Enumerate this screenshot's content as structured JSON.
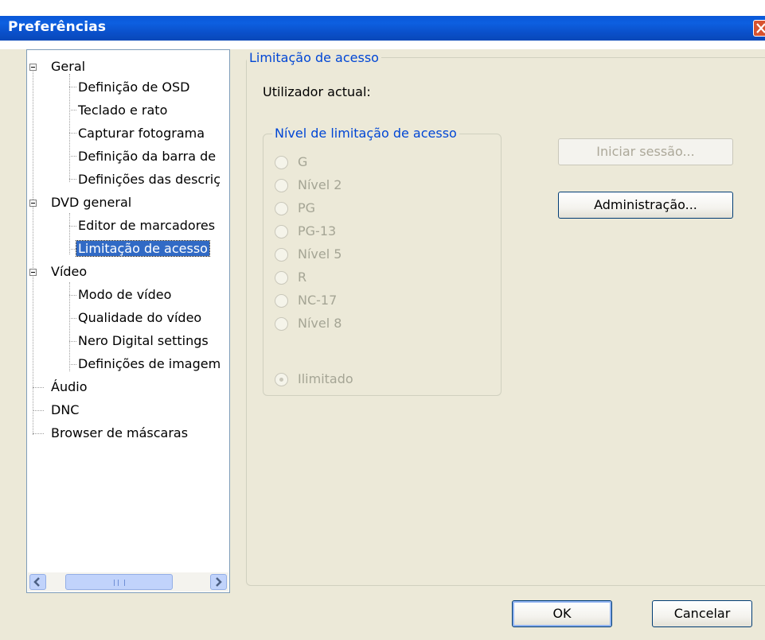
{
  "window": {
    "title": "Preferências",
    "close_icon": "close-icon"
  },
  "tree": {
    "items": [
      {
        "label": "Geral",
        "level": 0,
        "expanded": true
      },
      {
        "label": "Definição de OSD",
        "level": 1
      },
      {
        "label": "Teclado e rato",
        "level": 1
      },
      {
        "label": "Capturar fotograma",
        "level": 1
      },
      {
        "label": "Definição da barra de",
        "level": 1
      },
      {
        "label": "Definições das descriç",
        "level": 1
      },
      {
        "label": "DVD general",
        "level": 0,
        "expanded": true
      },
      {
        "label": "Editor de marcadores",
        "level": 1
      },
      {
        "label": "Limitação de acesso",
        "level": 1,
        "selected": true
      },
      {
        "label": "Vídeo",
        "level": 0,
        "expanded": true
      },
      {
        "label": "Modo de vídeo",
        "level": 1
      },
      {
        "label": "Qualidade do vídeo",
        "level": 1
      },
      {
        "label": "Nero Digital settings",
        "level": 1
      },
      {
        "label": "Definições de imagem",
        "level": 1
      },
      {
        "label": "Áudio",
        "level": 0
      },
      {
        "label": "DNC",
        "level": 0
      },
      {
        "label": "Browser de máscaras",
        "level": 0
      }
    ]
  },
  "access": {
    "group_title": "Limitação de acesso",
    "current_user_label": "Utilizador actual:",
    "level_group_title": "Nível de limitação de acesso",
    "levels": [
      "G",
      "Nível 2",
      "PG",
      "PG-13",
      "Nível 5",
      "R",
      "NC-17",
      "Nível 8"
    ],
    "unlimited_label": "Ilimitado",
    "login_button": "Iniciar sessão...",
    "admin_button": "Administração..."
  },
  "footer": {
    "ok_label": "OK",
    "cancel_label": "Cancelar"
  },
  "colors": {
    "titlebar": "#0a58d8",
    "legend_text": "#0046d5",
    "selection": "#316ac5",
    "disabled_text": "#a5a595"
  }
}
